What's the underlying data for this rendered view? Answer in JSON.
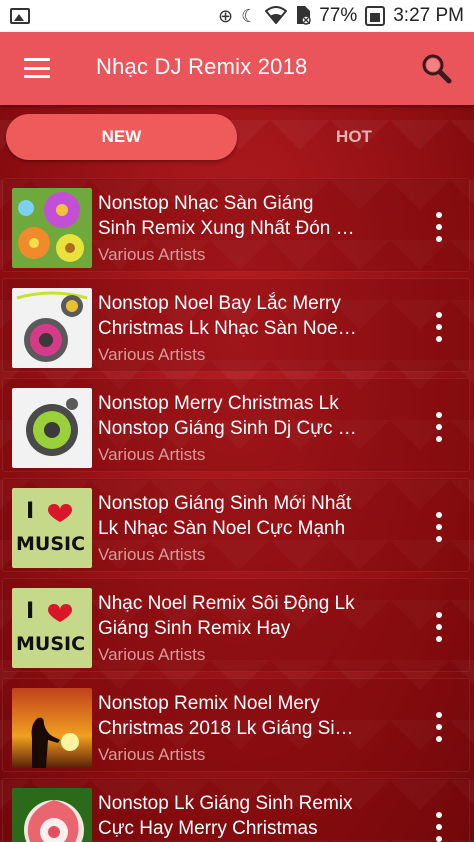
{
  "status_bar": {
    "battery": "77%",
    "time": "3:27 PM"
  },
  "app_bar": {
    "title": "Nhạc DJ Remix 2018"
  },
  "tabs": [
    {
      "label": "NEW",
      "selected": true
    },
    {
      "label": "HOT",
      "selected": false
    }
  ],
  "songs": [
    {
      "title_line1": "Nonstop Nhạc Sàn Giáng",
      "title_line2": "Sinh Remix Xung Nhất Đón …",
      "artist": "Various Artists",
      "thumb": "flowers"
    },
    {
      "title_line1": "Nonstop Noel Bay Lắc Merry",
      "title_line2": "Christmas Lk Nhạc Sàn Noe…",
      "artist": "Various Artists",
      "thumb": "speaker-pink"
    },
    {
      "title_line1": "Nonstop Merry Christmas Lk",
      "title_line2": "Nonstop Giáng Sinh Dj Cực …",
      "artist": "Various Artists",
      "thumb": "speaker-green"
    },
    {
      "title_line1": "Nonstop Giáng Sinh Mới Nhất",
      "title_line2": "Lk Nhạc Sàn Noel Cực Mạnh",
      "artist": "Various Artists",
      "thumb": "i-love-music"
    },
    {
      "title_line1": "Nhạc Noel Remix Sôi Động Lk",
      "title_line2": "Giáng Sinh Remix Hay",
      "artist": "Various Artists",
      "thumb": "i-love-music"
    },
    {
      "title_line1": "Nonstop Remix Noel Mery",
      "title_line2": "Christmas 2018 Lk Giáng Si…",
      "artist": "Various Artists",
      "thumb": "sunset-silhouette"
    },
    {
      "title_line1": "Nonstop Lk Giáng Sinh Remix",
      "title_line2": "Cực Hay Merry Christmas",
      "artist": "",
      "thumb": "rose"
    }
  ],
  "thumb_text": {
    "i": "I",
    "music": "MUSIC"
  },
  "colors": {
    "app_bar": "#e9555a",
    "tab_selected": "#ef5b5b",
    "background": "#8e0f12",
    "artist_text": "#d89a9a"
  }
}
